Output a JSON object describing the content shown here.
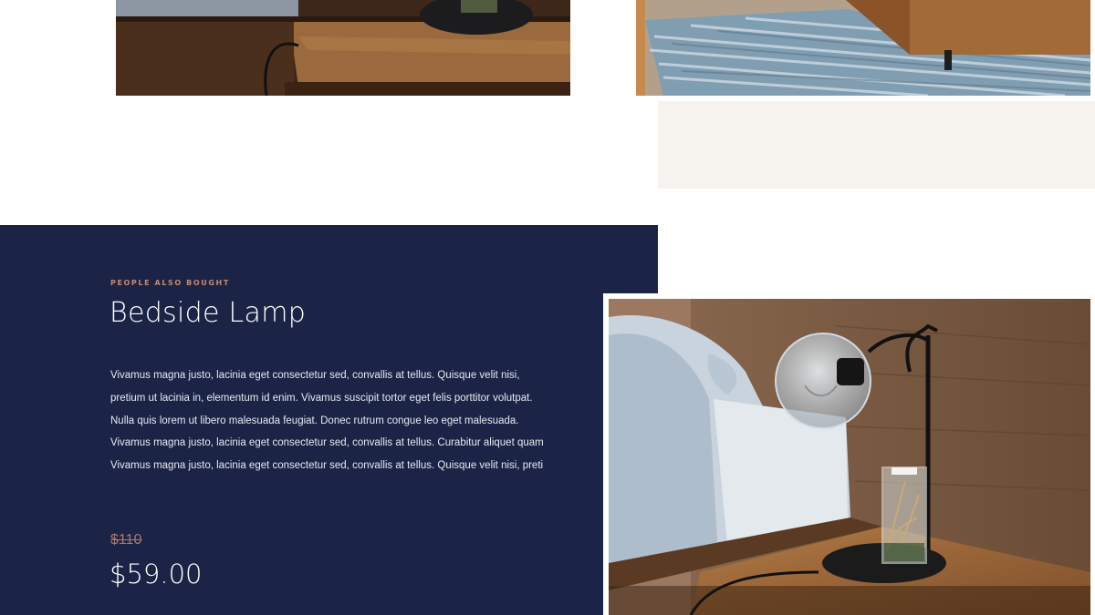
{
  "section": {
    "eyebrow": "PEOPLE ALSO BOUGHT",
    "title": "Bedside Lamp",
    "description": "Vivamus magna justo, lacinia eget consectetur sed, convallis at tellus. Quisque velit nisi, pretium ut lacinia in, elementum id enim. Vivamus suscipit tortor eget felis porttitor volutpat. Nulla quis lorem ut libero malesuada feugiat. Donec rutrum congue leo eget malesuada. Vivamus magna justo, lacinia eget consectetur sed, convallis at tellus. Curabitur aliquet quam Vivamus magna justo, lacinia eget consectetur sed, convallis at tellus. Quisque velit nisi, preti",
    "price_old": "$110",
    "price_new": "$59.00"
  },
  "colors": {
    "panel_background": "#1b2447",
    "accent": "#c8896a",
    "beige_block": "#f6f3ee"
  }
}
